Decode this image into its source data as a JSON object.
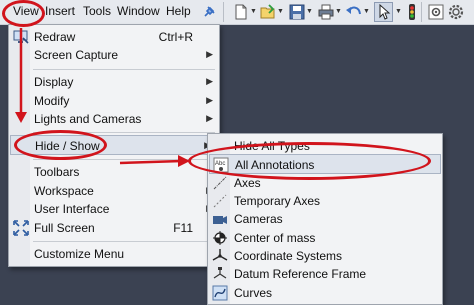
{
  "menubar": {
    "items": [
      {
        "id": "view",
        "label": "View"
      },
      {
        "id": "insert",
        "label": "Insert"
      },
      {
        "id": "tools",
        "label": "Tools"
      },
      {
        "id": "window",
        "label": "Window"
      },
      {
        "id": "help",
        "label": "Help"
      }
    ],
    "toolbar_icons": [
      "pin-icon",
      "new-document-icon",
      "open-file-icon",
      "save-icon",
      "print-icon",
      "undo-icon",
      "select-pointer-icon",
      "traffic-light-icon",
      "options-icon",
      "settings-gear-icon"
    ]
  },
  "view_menu": {
    "items": [
      {
        "label": "Redraw",
        "shortcut": "Ctrl+R",
        "icon": "redraw-monitor-icon"
      },
      {
        "label": "Screen Capture",
        "submenu": true
      },
      {
        "label": "Display",
        "submenu": true
      },
      {
        "label": "Modify",
        "submenu": true
      },
      {
        "label": "Lights and Cameras",
        "submenu": true
      },
      {
        "label": "Hide / Show",
        "submenu": true,
        "highlighted": true
      },
      {
        "label": "Toolbars"
      },
      {
        "label": "Workspace",
        "submenu": true
      },
      {
        "label": "User Interface",
        "submenu": true
      },
      {
        "label": "Full Screen",
        "shortcut": "F11",
        "icon": "fullscreen-icon"
      },
      {
        "label": "Customize Menu"
      }
    ]
  },
  "hide_show_submenu": {
    "items": [
      {
        "label": "Hide All Types"
      },
      {
        "label": "All Annotations",
        "icon": "annotations-icon",
        "highlighted": true
      },
      {
        "label": "Axes",
        "icon": "axes-icon"
      },
      {
        "label": "Temporary Axes",
        "icon": "temporary-axes-icon"
      },
      {
        "label": "Cameras",
        "icon": "camera-icon"
      },
      {
        "label": "Center of mass",
        "icon": "center-of-mass-icon"
      },
      {
        "label": "Coordinate Systems",
        "icon": "coordinate-system-icon"
      },
      {
        "label": "Datum Reference Frame",
        "icon": "datum-reference-frame-icon"
      },
      {
        "label": "Curves",
        "icon": "curves-icon"
      }
    ]
  },
  "colors": {
    "annotation_red": "#d1141c",
    "menu_bg": "#f2f3f5",
    "highlight": "#dde3ec",
    "workspace_bg": "#3b4252"
  }
}
